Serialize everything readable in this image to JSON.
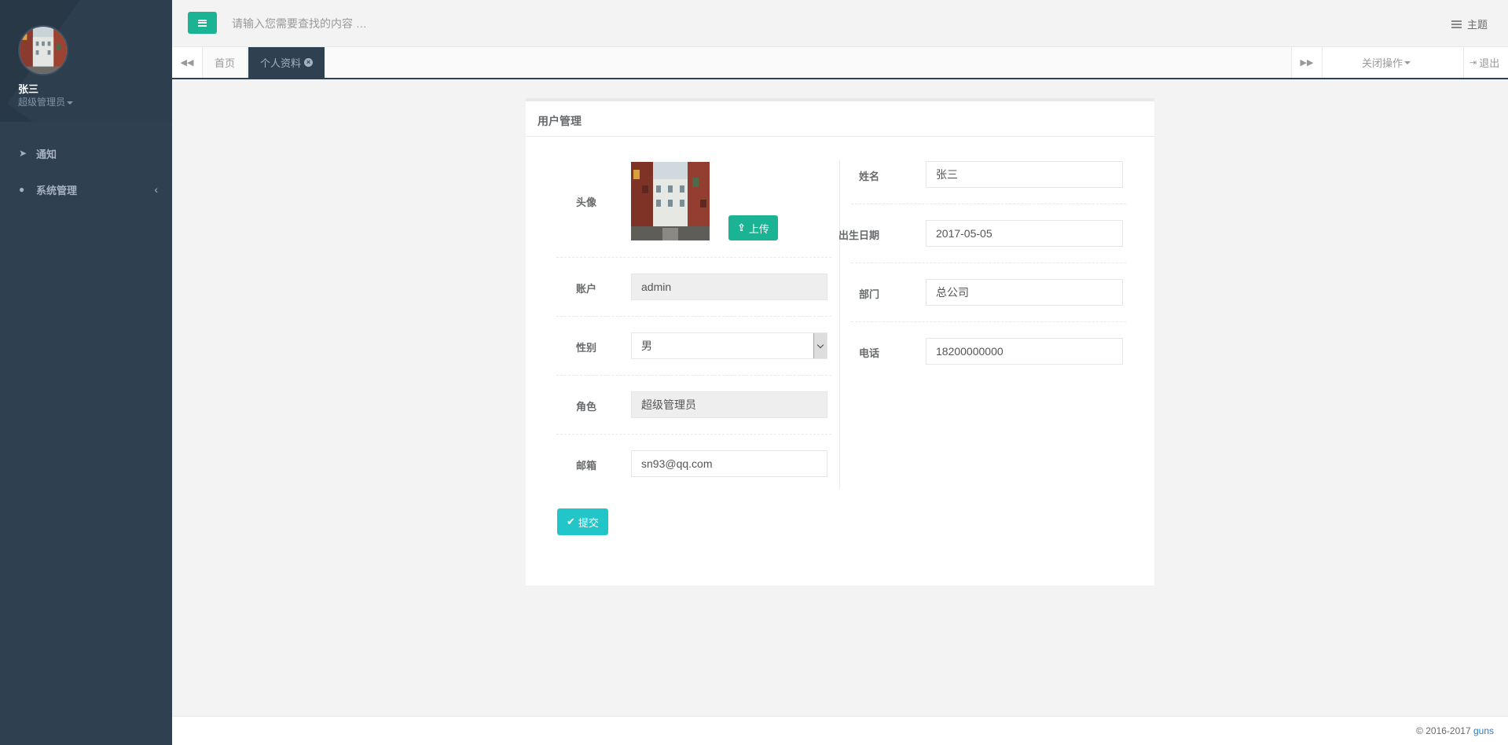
{
  "sidebar": {
    "user": {
      "name": "张三",
      "role": "超级管理员"
    },
    "items": [
      {
        "label": "通知",
        "icon": "rocket-icon"
      },
      {
        "label": "系统管理",
        "icon": "user-icon",
        "arrow": "‹"
      }
    ]
  },
  "topbar": {
    "search_placeholder": "请输入您需要查找的内容 …",
    "theme_label": "主题"
  },
  "tabs": {
    "items": [
      {
        "label": "首页",
        "active": false
      },
      {
        "label": "个人资料",
        "active": true
      }
    ],
    "close_ops_label": "关闭操作",
    "logout_label": "退出"
  },
  "card": {
    "title": "用户管理",
    "left": {
      "avatar_label": "头像",
      "upload_label": "上传",
      "account_label": "账户",
      "account_value": "admin",
      "gender_label": "性别",
      "gender_value": "男",
      "role_label": "角色",
      "role_value": "超级管理员",
      "email_label": "邮箱",
      "email_value": "sn93@qq.com"
    },
    "right": {
      "name_label": "姓名",
      "name_value": "张三",
      "birthday_label": "出生日期",
      "birthday_value": "2017-05-05",
      "dept_label": "部门",
      "dept_value": "总公司",
      "phone_label": "电话",
      "phone_value": "18200000000"
    },
    "submit_label": "提交"
  },
  "footer": {
    "copyright": "© 2016-2017",
    "brand": "guns"
  },
  "colors": {
    "sidebar_bg": "#2f4050",
    "primary": "#1ab394",
    "info": "#23c6c8",
    "link": "#337ab7"
  }
}
